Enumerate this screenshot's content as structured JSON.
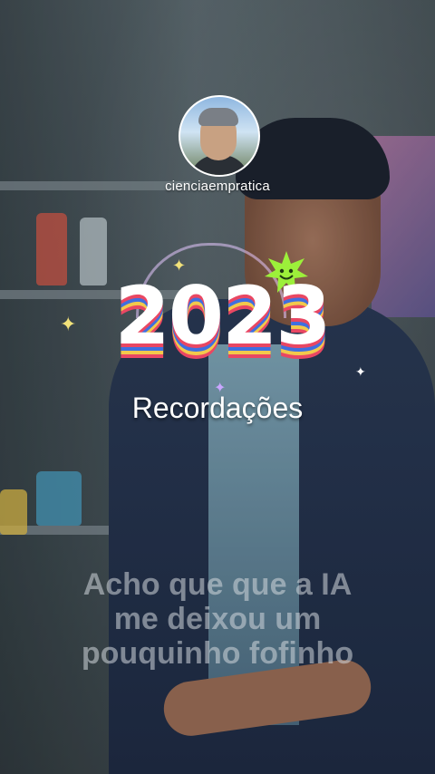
{
  "profile": {
    "username": "cienciaempratica"
  },
  "story": {
    "year": "2023",
    "subtitle": "Recordações",
    "caption_lines": [
      "Acho que que a IA",
      "me deixou um",
      "pouquinho fofinho"
    ]
  },
  "colors": {
    "year_shadow_red": "#e94763",
    "year_shadow_blue": "#3f6fe0",
    "year_shadow_yellow": "#f2c94c",
    "star_green": "#9cf03a"
  },
  "icons": {
    "avatar": "profile-photo",
    "sticker": "smiling-star-icon"
  }
}
